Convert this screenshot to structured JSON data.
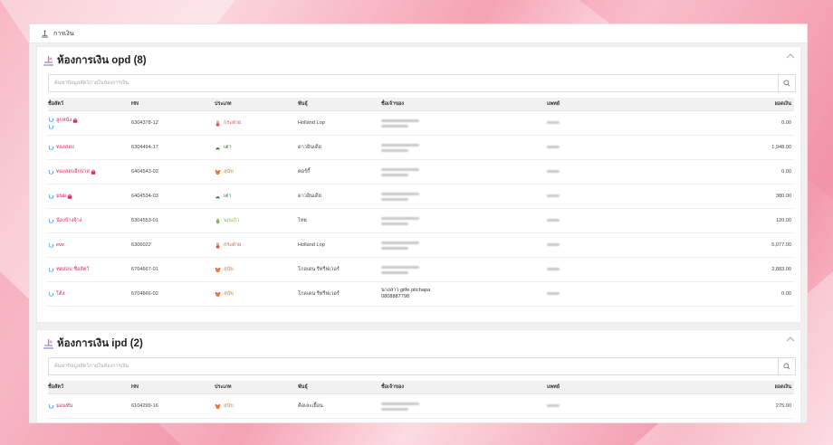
{
  "breadcrumb": {
    "label": "การเงิน"
  },
  "colors": {
    "accent": "#e0245e",
    "cat": "#e74c3c",
    "dog": "#e67e22",
    "cow": "#2e7d32",
    "bird": "#66bb6a"
  },
  "columns": [
    "ชื่อสัตว์",
    "HN",
    "ประเภท",
    "พันธุ์",
    "ชื่อเจ้าของ",
    "แพทย์",
    "ยอดเงิน"
  ],
  "opd": {
    "title": "ห้องการเงิน opd (8)",
    "search_placeholder": "ค้นหาข้อมูลสัตว์ภายในห้องการเงิน",
    "rows": [
      {
        "name": "ลูกหนัง",
        "locked": true,
        "second_icon": true,
        "hn": "6304378-12",
        "type": "กระต่าย",
        "type_icon": "rabbit-icon",
        "breed": "Holland Lop",
        "owner_blur": true,
        "amount": "0.00"
      },
      {
        "name": "ทองสอบ",
        "locked": false,
        "second_icon": false,
        "hn": "6304494-17",
        "type": "เต่า",
        "type_icon": "turtle-icon",
        "breed": "ดาวอินเดีย",
        "owner_blur": true,
        "amount": "1,948.00"
      },
      {
        "name": "ทองสอบอีกปาส",
        "locked": true,
        "second_icon": false,
        "hn": "6404543-02",
        "type": "สุนัข",
        "type_icon": "dog-icon",
        "breed": "คอร์กี้",
        "owner_blur": true,
        "amount": "0.00"
      },
      {
        "name": "มนม",
        "locked": true,
        "second_icon": false,
        "hn": "6404534-03",
        "type": "เต่า",
        "type_icon": "turtle-icon",
        "breed": "ดาวอินเดีย",
        "owner_blur": true,
        "amount": "380.00"
      },
      {
        "name": "น้องบ้างจ้าง",
        "locked": false,
        "second_icon": false,
        "hn": "6304553-01",
        "type": "นกแก้ว",
        "type_icon": "parrot-icon",
        "breed": "ไทย",
        "owner_blur": true,
        "amount": "120.00"
      },
      {
        "name": "eve",
        "locked": false,
        "second_icon": false,
        "hn": "6306022",
        "type": "กระต่าย",
        "type_icon": "rabbit-icon",
        "breed": "Holland Lop",
        "owner_blur": true,
        "amount": "5,077.00"
      },
      {
        "name": "ทดสอบ ชื่อสัตว์",
        "locked": false,
        "second_icon": false,
        "hn": "6704667-01",
        "type": "สุนัข",
        "type_icon": "dog-icon",
        "breed": "โกลเดน รีทรีฟเวอร์",
        "owner_blur": true,
        "amount": "2,883.00"
      },
      {
        "name": "โต้ง",
        "locked": false,
        "second_icon": false,
        "hn": "6704666-02",
        "type": "สุนัข",
        "type_icon": "dog-icon",
        "breed": "โกลเดน รีทรีฟเวอร์",
        "owner_blur": false,
        "owner_line1": "นางสาว gitfe pitchapa",
        "owner_line2": "0808887798",
        "amount": "0.00"
      }
    ]
  },
  "ipd": {
    "title": "ห้องการเงิน ipd (2)",
    "search_placeholder": "ค้นหาข้อมูลสัตว์ภายในห้องการเงิน",
    "rows": [
      {
        "name": "มอนทัน",
        "locked": false,
        "second_icon": false,
        "hn": "6104299-16",
        "type": "สุนัข",
        "type_icon": "dog-icon",
        "breed": "ค็อเละเยื้อน",
        "owner_blur": true,
        "amount": "275.00"
      }
    ]
  }
}
